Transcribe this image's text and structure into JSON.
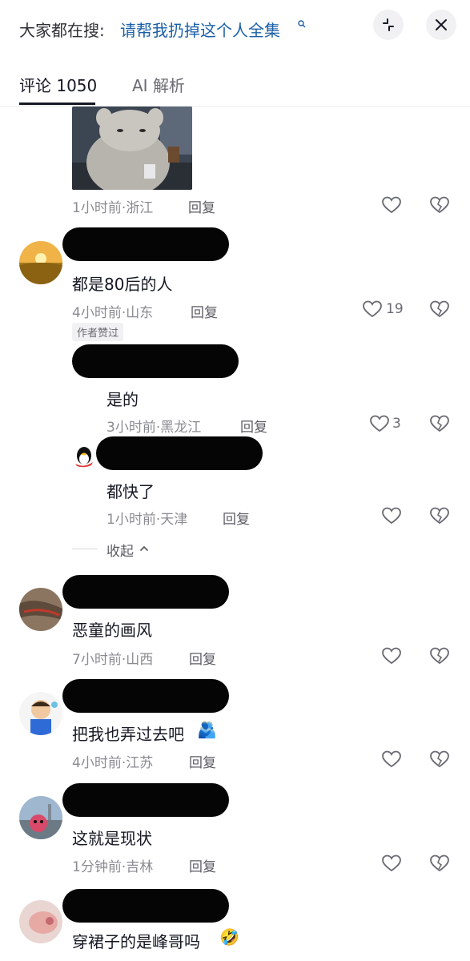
{
  "header": {
    "search_prefix": "大家都在搜:",
    "search_query": "请帮我扔掉这个人全集"
  },
  "tabs": [
    {
      "label": "评论 1050"
    },
    {
      "label": "AI 解析"
    }
  ],
  "comments": [
    {
      "time_location": "1小时前·浙江",
      "reply": "回复"
    },
    {
      "text": "都是80后的人",
      "time_location": "4小时前·山东",
      "reply": "回复",
      "likes": "19",
      "badge": "作者赞过",
      "replies": [
        {
          "text": "是的",
          "time_location": "3小时前·黑龙江",
          "reply": "回复",
          "likes": "3"
        },
        {
          "text": "都快了",
          "time_location": "1小时前·天津",
          "reply": "回复"
        }
      ],
      "collapse": "收起"
    },
    {
      "text": "恶童的画风",
      "time_location": "7小时前·山西",
      "reply": "回复"
    },
    {
      "text": "把我也弄过去吧",
      "time_location": "4小时前·江苏",
      "reply": "回复"
    },
    {
      "text": "这就是现状",
      "time_location": "1分钟前·吉林",
      "reply": "回复"
    },
    {
      "text": "穿裙子的是峰哥吗"
    }
  ]
}
